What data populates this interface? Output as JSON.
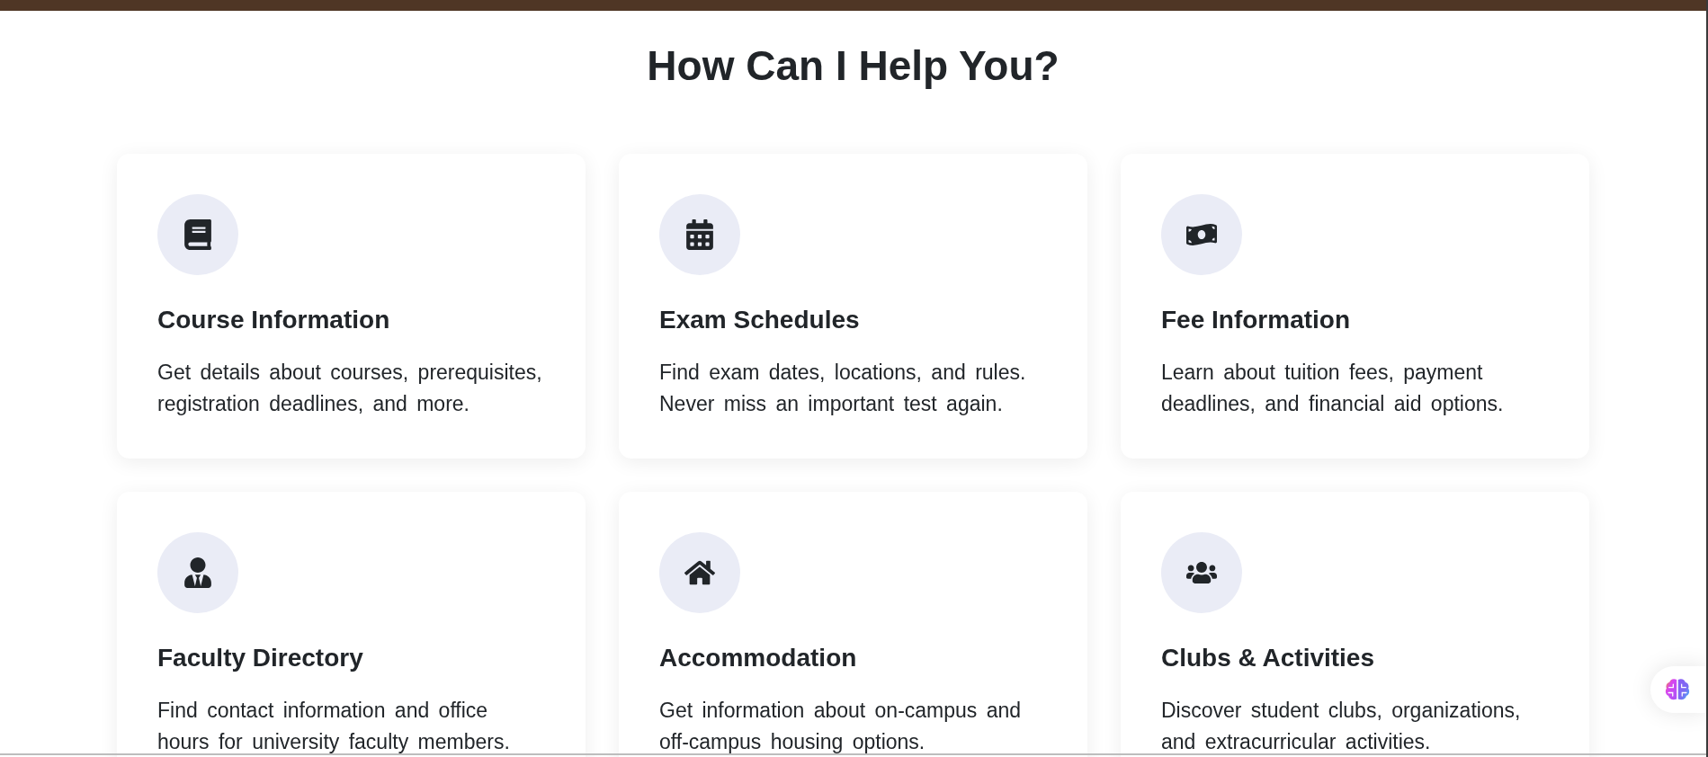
{
  "heading": "How Can I Help You?",
  "cards": [
    {
      "title": "Course Information",
      "description": "Get details about courses, prerequisites, registration deadlines, and more."
    },
    {
      "title": "Exam Schedules",
      "description": "Find exam dates, locations, and rules. Never miss an important test again."
    },
    {
      "title": "Fee Information",
      "description": "Learn about tuition fees, payment deadlines, and financial aid options."
    },
    {
      "title": "Faculty Directory",
      "description": "Find contact information and office hours for university faculty members."
    },
    {
      "title": "Accommodation",
      "description": "Get information about on-campus and off-campus housing options."
    },
    {
      "title": "Clubs & Activities",
      "description": "Discover student clubs, organizations, and extracurricular activities."
    }
  ]
}
